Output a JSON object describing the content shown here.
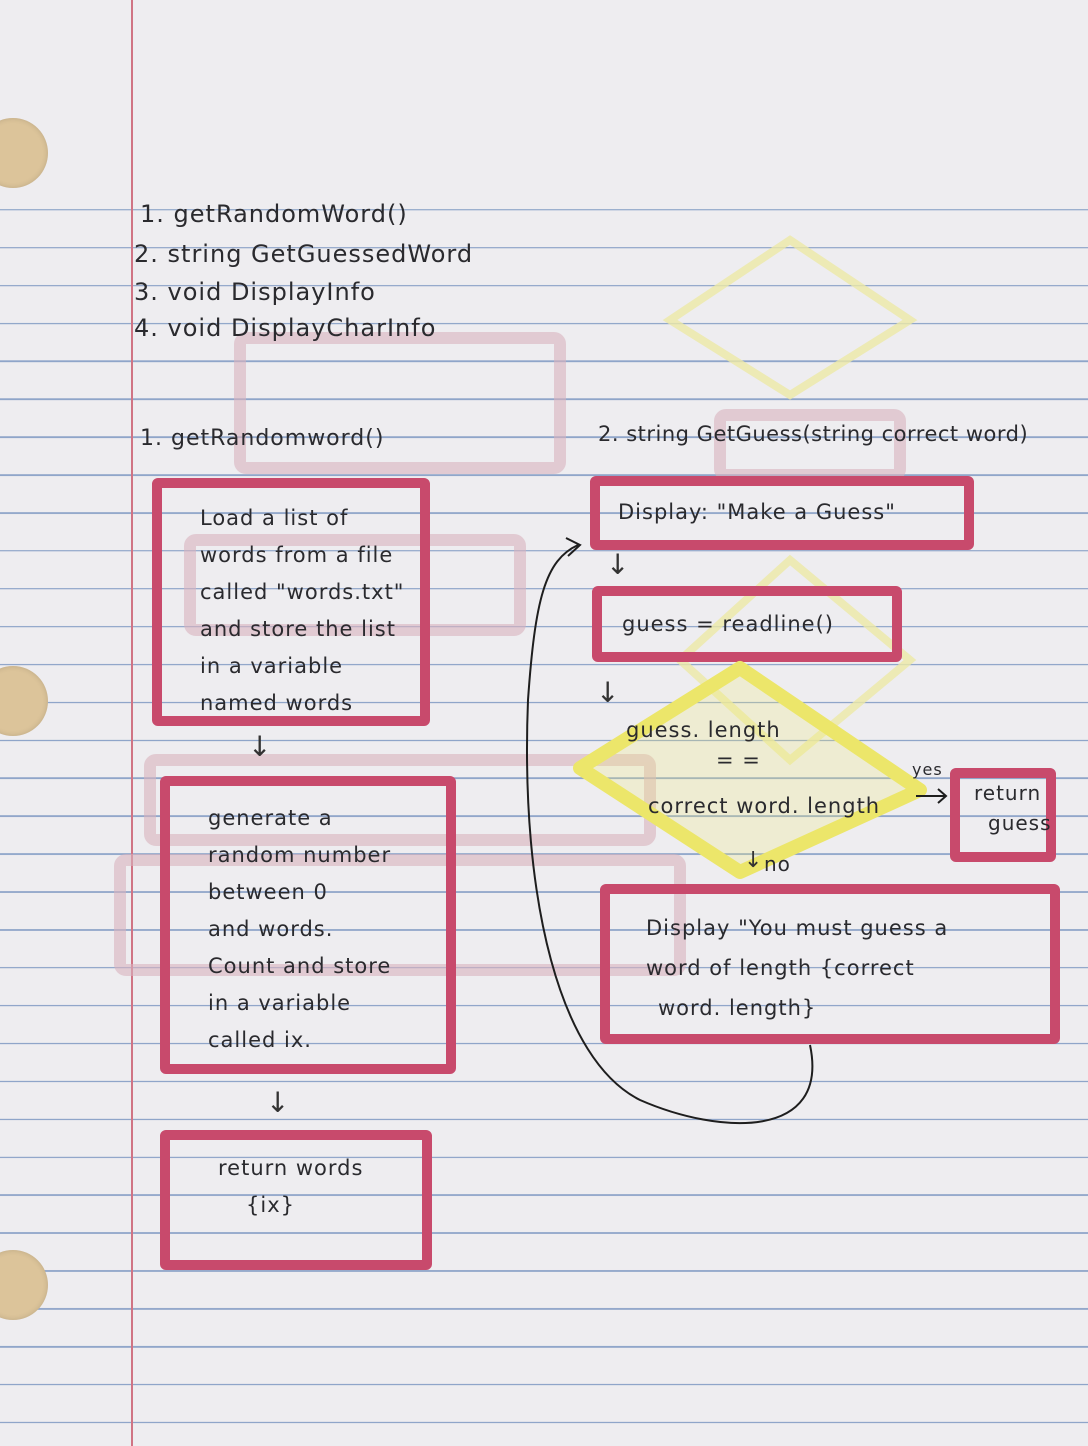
{
  "function_list": [
    "1. getRandomWord()",
    "2. string GetGuessedWord",
    "3. void DisplayInfo",
    "4. void DisplayCharInfo"
  ],
  "left_flow": {
    "title": "1. getRandomword()",
    "box1": [
      "Load a list of",
      "words from a file",
      "called \"words.txt\"",
      "and store the list",
      "in a variable",
      "named words"
    ],
    "box2": [
      "generate a",
      "random number",
      "between 0",
      "and words.",
      "Count and store",
      "in a variable",
      "called ix."
    ],
    "box3": [
      "return words",
      "{ix}"
    ]
  },
  "right_flow": {
    "title": "2. string GetGuess(string correct word)",
    "display_box": "Display: \"Make a Guess\"",
    "guess_box": "guess = readline()",
    "decision": [
      "guess. length",
      "= =",
      "correct word. length"
    ],
    "yes_label": "yes",
    "no_label": "no",
    "return_box": [
      "return",
      "guess"
    ],
    "error_box": [
      "Display \"You must guess a",
      "word of length {correct",
      "word. length}"
    ]
  }
}
